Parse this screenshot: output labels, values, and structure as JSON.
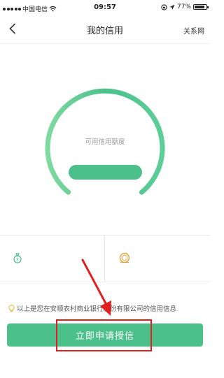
{
  "status_bar": {
    "carrier": "中国电信",
    "time": "09:57",
    "battery": "77%"
  },
  "header": {
    "back_icon": "chevron-left-icon",
    "title": "我的信用",
    "contact_label": "关系网"
  },
  "credit": {
    "label": "可用信用额度"
  },
  "notice": {
    "icon": "lightbulb-icon",
    "text": "以上是您在安顺农村商业银行股份有限公司的信用信息"
  },
  "apply_button": {
    "label": "立即申请授信"
  },
  "colors": {
    "accent": "#4cc08a",
    "highlight": "#e02020"
  }
}
